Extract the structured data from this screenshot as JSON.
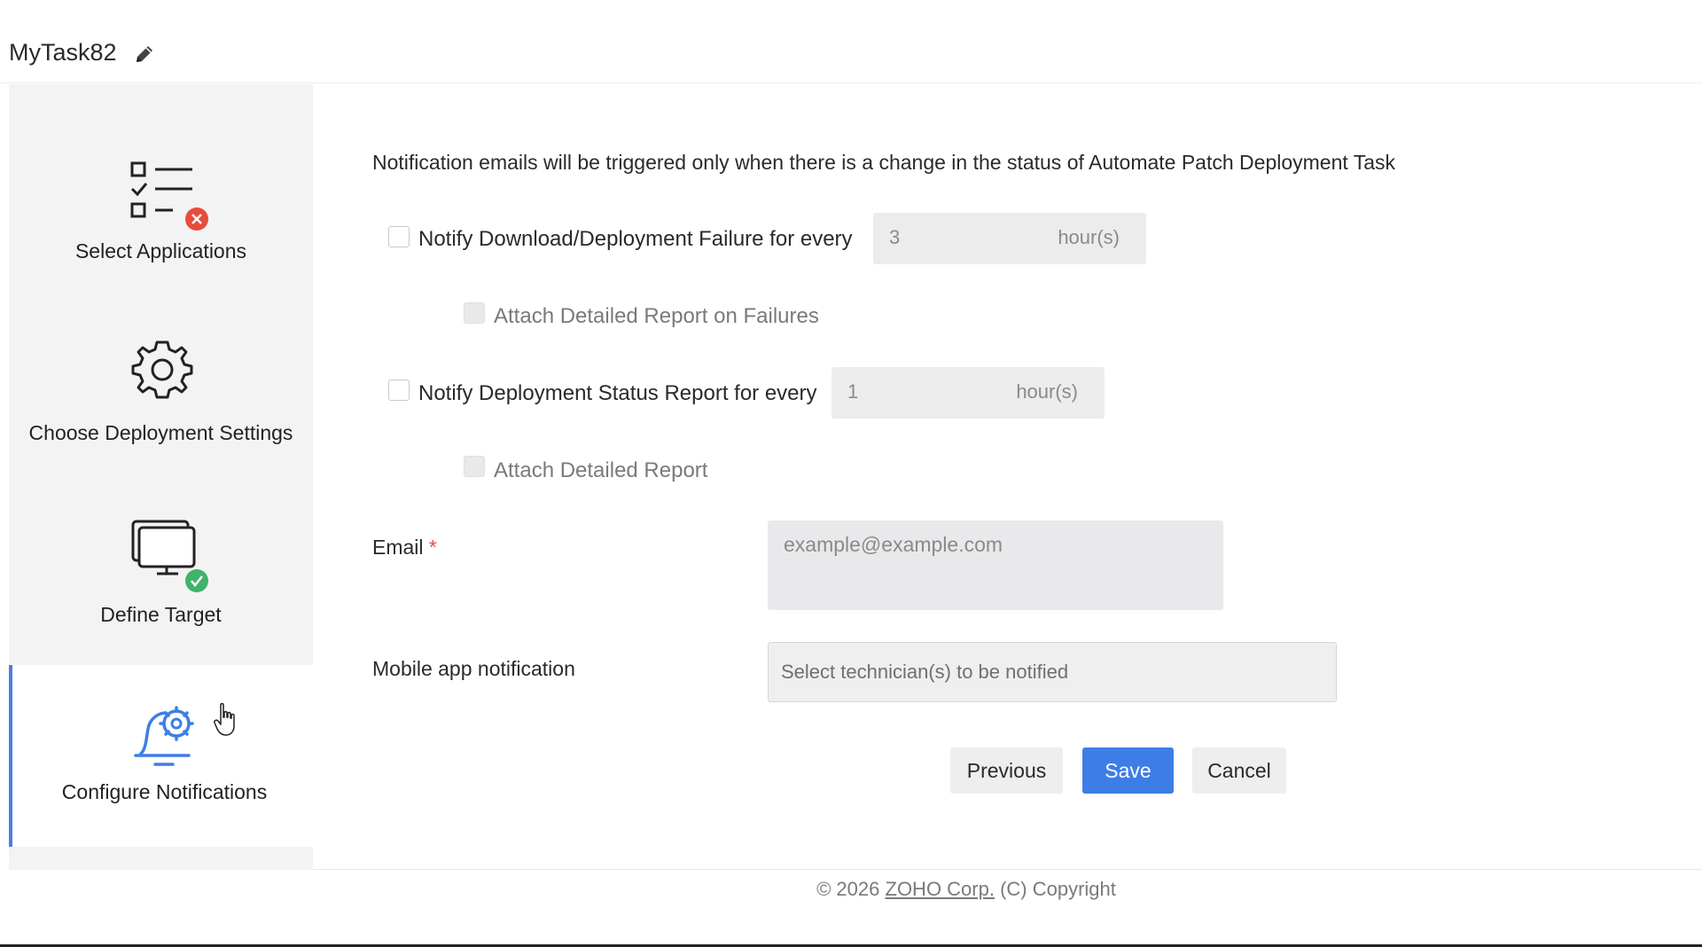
{
  "task": {
    "title": "MyTask82",
    "edit_icon": "pencil-icon"
  },
  "sidebar": {
    "steps": [
      {
        "label": "Select Applications",
        "icon": "checklist-icon",
        "status": "error"
      },
      {
        "label": "Choose Deployment Settings",
        "icon": "gear-icon",
        "status": "none"
      },
      {
        "label": "Define Target",
        "icon": "monitor-icon",
        "status": "done"
      },
      {
        "label": "Configure Notifications",
        "icon": "bell-gear-icon",
        "status": "active"
      }
    ]
  },
  "main": {
    "info_text": "Notification emails will be triggered only when there is a change in the status of Automate Patch Deployment Task",
    "failure_option": {
      "label": "Notify Download/Deployment Failure for every",
      "checked": false,
      "value": "3",
      "unit": "hour(s)"
    },
    "failure_attach": {
      "label": "Attach Detailed Report on Failures",
      "checked": false
    },
    "status_option": {
      "label": "Notify Deployment Status Report for every",
      "checked": false,
      "value": "1",
      "unit": "hour(s)"
    },
    "status_attach": {
      "label": "Attach Detailed Report",
      "checked": false
    },
    "email": {
      "label": "Email",
      "required_mark": "*",
      "placeholder": "example@example.com",
      "value": ""
    },
    "mobile": {
      "label": "Mobile app notification",
      "placeholder": "Select technician(s) to be notified"
    },
    "buttons": {
      "previous": "Previous",
      "save": "Save",
      "cancel": "Cancel"
    }
  },
  "footer": {
    "prefix": "© 2026 ",
    "link": "ZOHO Corp.",
    "suffix": " (C) Copyright"
  },
  "colors": {
    "accent": "#3d7ee6",
    "error": "#e74c3c",
    "success": "#3fb36b"
  }
}
